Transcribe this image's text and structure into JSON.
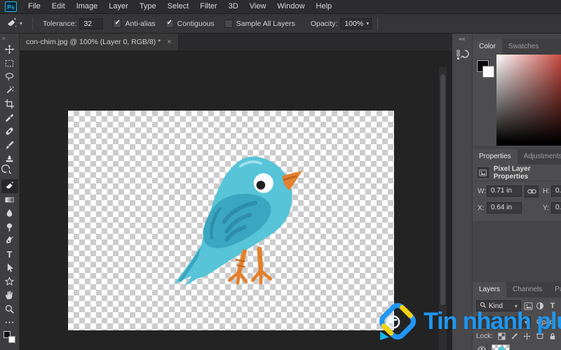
{
  "menu_bar": {
    "logo": "Ps",
    "items": [
      "File",
      "Edit",
      "Image",
      "Layer",
      "Type",
      "Select",
      "Filter",
      "3D",
      "View",
      "Window",
      "Help"
    ]
  },
  "options_bar": {
    "tool": "magic-eraser",
    "tolerance_label": "Tolerance:",
    "tolerance_value": "32",
    "checkboxes": [
      {
        "label": "Anti-alias",
        "checked": true
      },
      {
        "label": "Contiguous",
        "checked": true
      },
      {
        "label": "Sample All Layers",
        "checked": false
      }
    ],
    "opacity_label": "Opacity:",
    "opacity_value": "100%"
  },
  "toolbar": {
    "collapse_glyph": "»",
    "selected_tool": "magic-eraser",
    "tools": [
      "move",
      "rectangular-marquee",
      "lasso",
      "magic-wand",
      "crop",
      "eyedropper",
      "spot-healing",
      "brush",
      "clone-stamp",
      "history-brush",
      "magic-eraser",
      "gradient",
      "blur",
      "dodge",
      "pen",
      "type",
      "path-selection",
      "custom-shape",
      "hand",
      "zoom",
      "edit-toolbar"
    ]
  },
  "document_tab": {
    "title": "con-chim.jpg @ 100% (Layer 0, RGB/8) *",
    "close": "×"
  },
  "dock": {
    "collapse_glyph": "««",
    "color_panel": {
      "tabs": [
        "Color",
        "Swatches"
      ],
      "active_tab": "Color"
    },
    "properties_panel": {
      "tabs": [
        "Properties",
        "Adjustments"
      ],
      "active_tab": "Properties",
      "header": "Pixel Layer Properties",
      "fields": {
        "w_label": "W:",
        "w_value": "0.71 in",
        "h_label": "H:",
        "h_value": "0.",
        "x_label": "X:",
        "x_value": "0.64 in",
        "y_label": "Y:",
        "y_value": "0."
      }
    },
    "layers_panel": {
      "tabs": [
        "Layers",
        "Channels",
        "Paths"
      ],
      "active_tab": "Layers",
      "filter_kind": "Kind",
      "opacity_label": "Opac",
      "lock_label": "Lock:"
    }
  },
  "canvas": {
    "image_subject": "blue cartoon bird on transparent checkerboard",
    "bird_colors": {
      "body": "#57c4d8",
      "wing": "#3ba6c0",
      "feather_detail": "#2d8ea9",
      "beak_legs": "#e2812f",
      "eye": "#ffffff",
      "pupil": "#1f1f1f"
    }
  },
  "watermark": {
    "text": "Tin nhanh plus",
    "color": "#1e96f0"
  }
}
